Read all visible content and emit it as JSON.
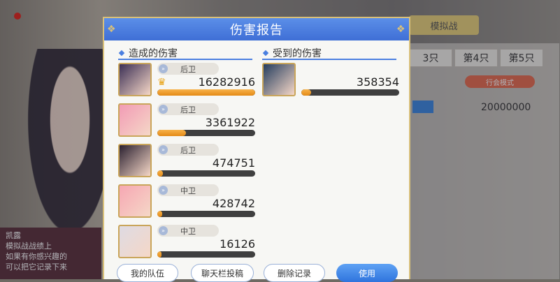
{
  "background": {
    "top_button": "模拟战",
    "tabs": [
      "3只",
      "第4只",
      "第5只"
    ],
    "mode_badge": "行会模式",
    "hp_value": "20000000",
    "chat_name": "凯露",
    "chat_lines": [
      "模拟战战绩上",
      "如果有你感兴趣的",
      "可以把它记录下来"
    ]
  },
  "dialog": {
    "title": "伤害报告",
    "dealt_title": "造成的伤害",
    "taken_title": "受到的伤害",
    "dealt": [
      {
        "position": "后卫",
        "value": "16282916",
        "crown": true,
        "fill": 1.0,
        "avatar_color": "#3b2f55"
      },
      {
        "position": "后卫",
        "value": "3361922",
        "crown": false,
        "fill": 0.29,
        "avatar_color": "#f29bb5"
      },
      {
        "position": "后卫",
        "value": "474751",
        "crown": false,
        "fill": 0.06,
        "avatar_color": "#2a2030"
      },
      {
        "position": "中卫",
        "value": "428742",
        "crown": false,
        "fill": 0.05,
        "avatar_color": "#f6a7b3"
      },
      {
        "position": "中卫",
        "value": "16126",
        "crown": false,
        "fill": 0.02,
        "avatar_color": "#dedbe3"
      }
    ],
    "taken": [
      {
        "value": "358354",
        "fill": 0.1,
        "avatar_color": "#243d5e"
      }
    ],
    "buttons": {
      "my_team": "我的队伍",
      "chat_post": "聊天栏投稿",
      "delete_record": "删除记录",
      "use": "使用"
    }
  },
  "colors": {
    "accent": "#3f6fd6",
    "bar": "#f0a02a",
    "gold": "#d8c07a"
  },
  "icons": {
    "crown": "crown-icon",
    "position": "position-icon"
  }
}
